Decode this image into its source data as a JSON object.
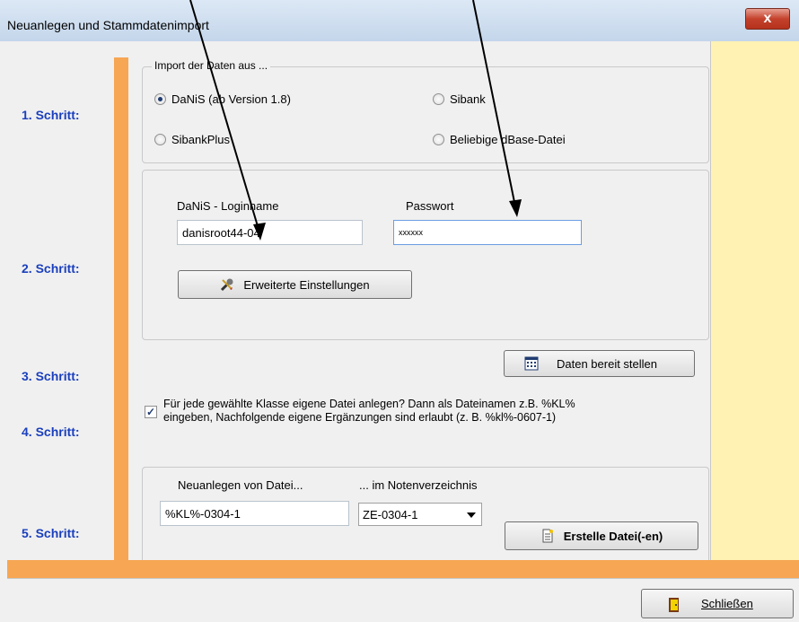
{
  "window": {
    "title": "Neuanlegen und Stammdatenimport",
    "close_glyph": "x"
  },
  "steps": [
    "1. Schritt:",
    "2. Schritt:",
    "3. Schritt:",
    "4. Schritt:",
    "5. Schritt:"
  ],
  "import": {
    "group_title": "Import der Daten aus ...",
    "options": [
      {
        "label": "DaNiS (ab Version 1.8)",
        "selected": true
      },
      {
        "label": "Sibank",
        "selected": false
      },
      {
        "label": "SibankPlus",
        "selected": false
      },
      {
        "label": "Beliebige dBase-Datei",
        "selected": false
      }
    ]
  },
  "login": {
    "loginname_label": "DaNiS - Loginname",
    "loginname_value": "danisroot44-04",
    "password_label": "Passwort",
    "password_value": "xxxxxx",
    "advanced_button": "Erweiterte Einstellungen"
  },
  "prepare": {
    "button": "Daten bereit stellen"
  },
  "class_files": {
    "checked": true,
    "text_line1": "Für jede gewählte Klasse eigene Datei anlegen? Dann als Dateinamen z.B. %KL%",
    "text_line2": "eingeben, Nachfolgende eigene Ergänzungen sind erlaubt (z. B. %kl%-0607-1)"
  },
  "create": {
    "file_label": "Neuanlegen  von Datei...",
    "dir_label": "... im Notenverzeichnis",
    "file_value": "%KL%-0304-1",
    "dir_value": "ZE-0304-1",
    "create_button": "Erstelle Datei(-en)"
  },
  "footer": {
    "close_button": "Schließen"
  },
  "colors": {
    "accent_orange": "#f7a653",
    "step_blue": "#1a3fbd",
    "right_panel": "#fff2b3"
  }
}
